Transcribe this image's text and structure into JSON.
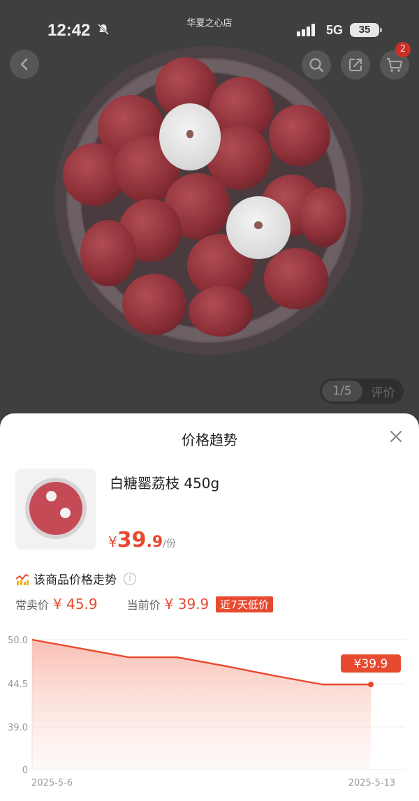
{
  "status_bar": {
    "time": "12:42",
    "store_name": "华夏之心店",
    "network": "5G",
    "battery": "35"
  },
  "nav": {
    "cart_count": "2"
  },
  "gallery": {
    "page_indicator": "1/5",
    "review_tab": "评价"
  },
  "sheet": {
    "title": "价格趋势",
    "product": {
      "name": "白糖罂荔枝 450g",
      "price_symbol": "¥",
      "price_int": "39",
      "price_dec": ".9",
      "price_unit": "/份"
    },
    "trend_title": "该商品价格走势",
    "regular_price_label": "常卖价",
    "regular_price": "¥ 45.9",
    "current_price_label": "当前价",
    "current_price": "¥ 39.9",
    "lowest_tag": "近7天低价"
  },
  "colors": {
    "accent": "#e84a30",
    "sheet_bg": "#ffffff",
    "dim_bg": "#3f3f3f"
  },
  "chart_data": {
    "type": "line",
    "x": [
      "2025-5-6",
      "2025-5-7",
      "2025-5-8",
      "2025-5-9",
      "2025-5-10",
      "2025-5-11",
      "2025-5-12",
      "2025-5-13"
    ],
    "x_tick_labels": [
      "2025-5-6",
      "2025-5-13"
    ],
    "series": [
      {
        "values": [
          50.0,
          48.9,
          47.8,
          47.8,
          46.7,
          45.5,
          44.4,
          44.4
        ]
      }
    ],
    "y_ticks": [
      "50.0",
      "44.5",
      "39.0",
      "0"
    ],
    "end_label": "¥39.9",
    "grid": true,
    "area_fill": true
  }
}
